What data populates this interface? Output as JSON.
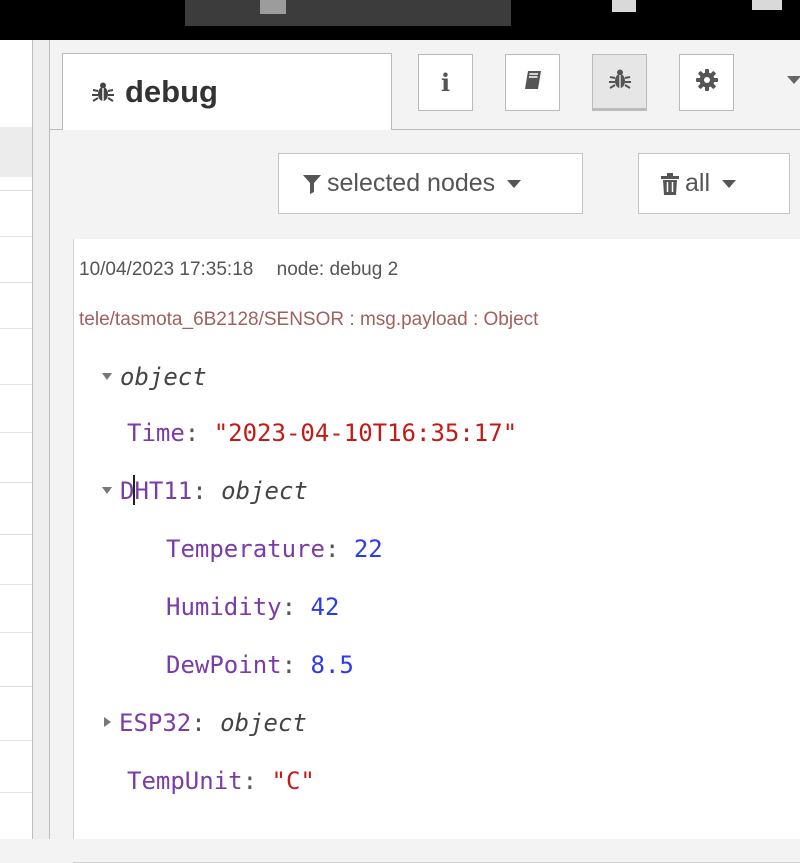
{
  "sidebar": {
    "tab_label": "debug",
    "tool_buttons": [
      {
        "icon": "info-icon",
        "label": "i"
      },
      {
        "icon": "book-icon"
      },
      {
        "icon": "bug-icon"
      },
      {
        "icon": "gear-icon"
      }
    ]
  },
  "filters": {
    "nodes_label": "selected nodes",
    "clear_label": "all"
  },
  "message": {
    "timestamp": "10/04/2023 17:35:18",
    "node": "node: debug 2",
    "topic": "tele/tasmota_6B2128/SENSOR",
    "property": "msg.payload",
    "type": "Object",
    "tree": {
      "root_type": "object",
      "time_key": "Time",
      "time_value": "\"2023-04-10T16:35:17\"",
      "dht_key": "DHT11",
      "dht_type": "object",
      "temperature_key": "Temperature",
      "temperature_value": "22",
      "humidity_key": "Humidity",
      "humidity_value": "42",
      "dewpoint_key": "DewPoint",
      "dewpoint_value": "8.5",
      "esp_key": "ESP32",
      "esp_type": "object",
      "tempunit_key": "TempUnit",
      "tempunit_value": "\"C\""
    }
  },
  "colors": {
    "key": "#7a3ca8",
    "string": "#c41a16",
    "number": "#2c3be8",
    "topic": "#a0605e"
  }
}
